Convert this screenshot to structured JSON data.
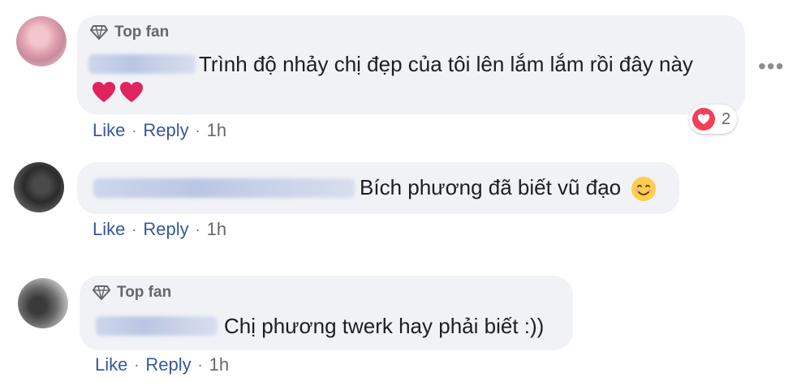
{
  "comments": [
    {
      "badge": "Top fan",
      "text": "Trình độ nhảy chị đẹp của tôi lên lắm lắm rồi đây này",
      "emoji_line": "❤❤",
      "reactions": {
        "icon": "love-icon",
        "count": "2"
      },
      "actions": {
        "like": "Like",
        "reply": "Reply",
        "time": "1h"
      },
      "more": "•••"
    },
    {
      "text": "Bích phương đã biết vũ đạo",
      "emoji": "😊",
      "actions": {
        "like": "Like",
        "reply": "Reply",
        "time": "1h"
      }
    },
    {
      "badge": "Top fan",
      "text": "Chị phương twerk hay phải biết :))",
      "actions": {
        "like": "Like",
        "reply": "Reply",
        "time": "1h"
      }
    }
  ],
  "colors": {
    "bubble": "#f0f2f5",
    "link": "#385898",
    "meta": "#65676b",
    "love": "#f33e58",
    "heart": "#e0245e"
  }
}
